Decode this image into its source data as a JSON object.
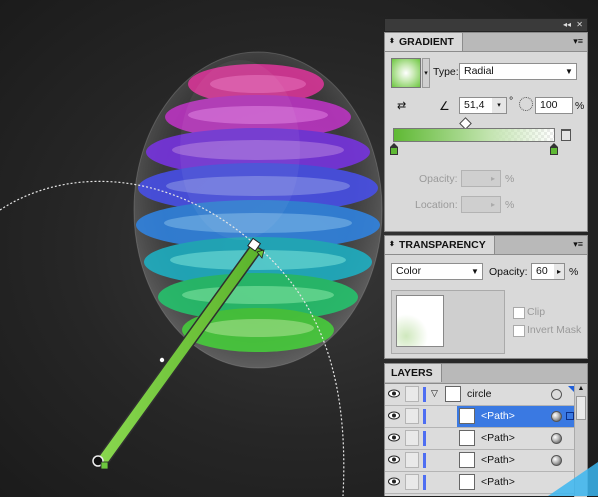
{
  "window": {
    "collapse_glyph": "◂◂",
    "close_glyph": "✕"
  },
  "gradient": {
    "title": "GRADIENT",
    "menu": "▾≡",
    "type_label": "Type:",
    "type_value": "Radial",
    "angle_value": "51,4",
    "degree_symbol": "°",
    "aspect_value": "100",
    "percent": "%",
    "opacity_label": "Opacity:",
    "location_label": "Location:",
    "stop_color_left": "#5fb934",
    "stop_color_right": "#e8e8e8"
  },
  "transparency": {
    "title": "TRANSPARENCY",
    "menu": "▾≡",
    "blend_mode": "Color",
    "opacity_label": "Opacity:",
    "opacity_value": "60",
    "percent": "%",
    "clip_label": "Clip",
    "invert_label": "Invert Mask"
  },
  "layers": {
    "title": "LAYERS",
    "rows": [
      {
        "name": "circle"
      },
      {
        "name": "<Path>"
      },
      {
        "name": "<Path>"
      },
      {
        "name": "<Path>"
      },
      {
        "name": "<Path>"
      }
    ]
  },
  "colors": {
    "accent_blue": "#3a79e2",
    "gradient_green": "#67bf3f"
  }
}
